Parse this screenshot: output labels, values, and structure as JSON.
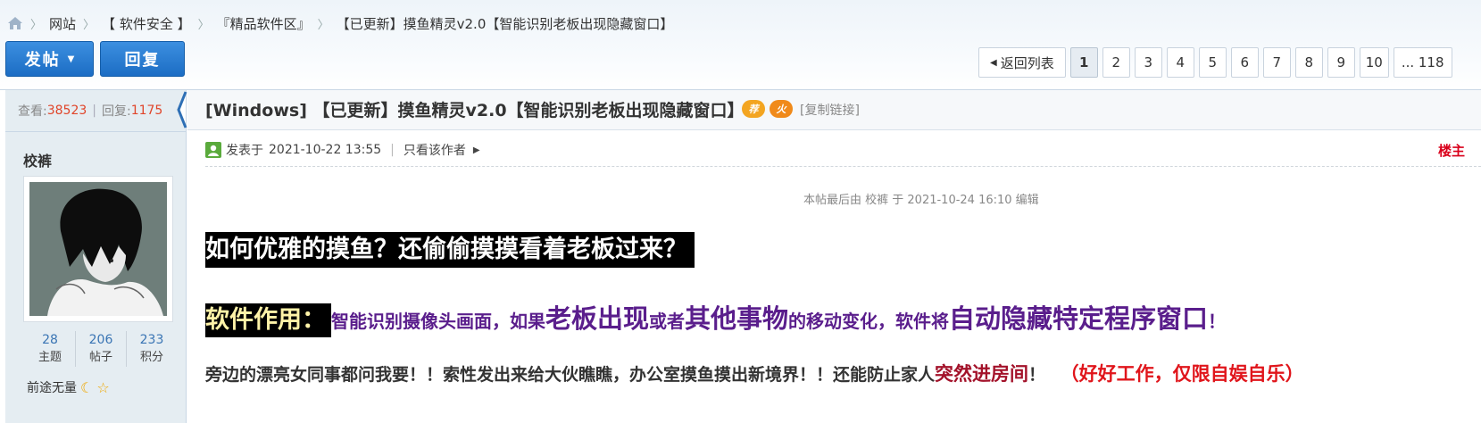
{
  "breadcrumb": {
    "items": [
      "网站",
      "【 软件安全 】",
      "『精品软件区』",
      "【已更新】摸鱼精灵v2.0【智能识别老板出现隐藏窗口】"
    ],
    "separator": "〉"
  },
  "toolbar": {
    "post_label": "发帖",
    "reply_label": "回复"
  },
  "pagination": {
    "back_label": "返回列表",
    "pages": [
      "1",
      "2",
      "3",
      "4",
      "5",
      "6",
      "7",
      "8",
      "9",
      "10"
    ],
    "current": "1",
    "last_label": "... 118"
  },
  "thread": {
    "views_label": "查看:",
    "views": "38523",
    "replies_label": "回复:",
    "replies": "1175",
    "title": "[Windows] 【已更新】摸鱼精灵v2.0【智能识别老板出现隐藏窗口】",
    "badge_recommend": "荐",
    "badge_hot": "火",
    "copy_link": "[复制链接]"
  },
  "author": {
    "name": "校裤",
    "stats": [
      {
        "value": "28",
        "label": "主题"
      },
      {
        "value": "206",
        "label": "帖子"
      },
      {
        "value": "233",
        "label": "积分"
      }
    ],
    "rank": "前途无量"
  },
  "post": {
    "posted_prefix": "发表于",
    "posted_time": "2021-10-22 13:55",
    "only_author": "只看该作者",
    "floor": "楼主",
    "edit_note": "本帖最后由 校裤 于 2021-10-24 16:10 编辑",
    "heading": "如何优雅的摸鱼？还偷偷摸摸看着老板过来？",
    "purpose_label": "软件作用：",
    "purpose_parts": [
      "智能识别摄像头画面，如果",
      "老板出现",
      "或者",
      "其他事物",
      "的移动变化，软件将",
      "自动隐藏特定程序窗口",
      "！"
    ],
    "line3_a": "旁边的漂亮女同事都问我要！！索性发出来给大伙瞧瞧，办公室摸鱼摸出新境界！！还能防止家人",
    "line3_b": "突然进房间",
    "line3_c": "！",
    "line3_d": "（好好工作，仅限自娱自乐）"
  },
  "colors": {
    "accent_blue": "#1c6dc4",
    "count_red": "#e0452a",
    "floor_red": "#d9001b",
    "purple_text": "#5a1e8c"
  }
}
